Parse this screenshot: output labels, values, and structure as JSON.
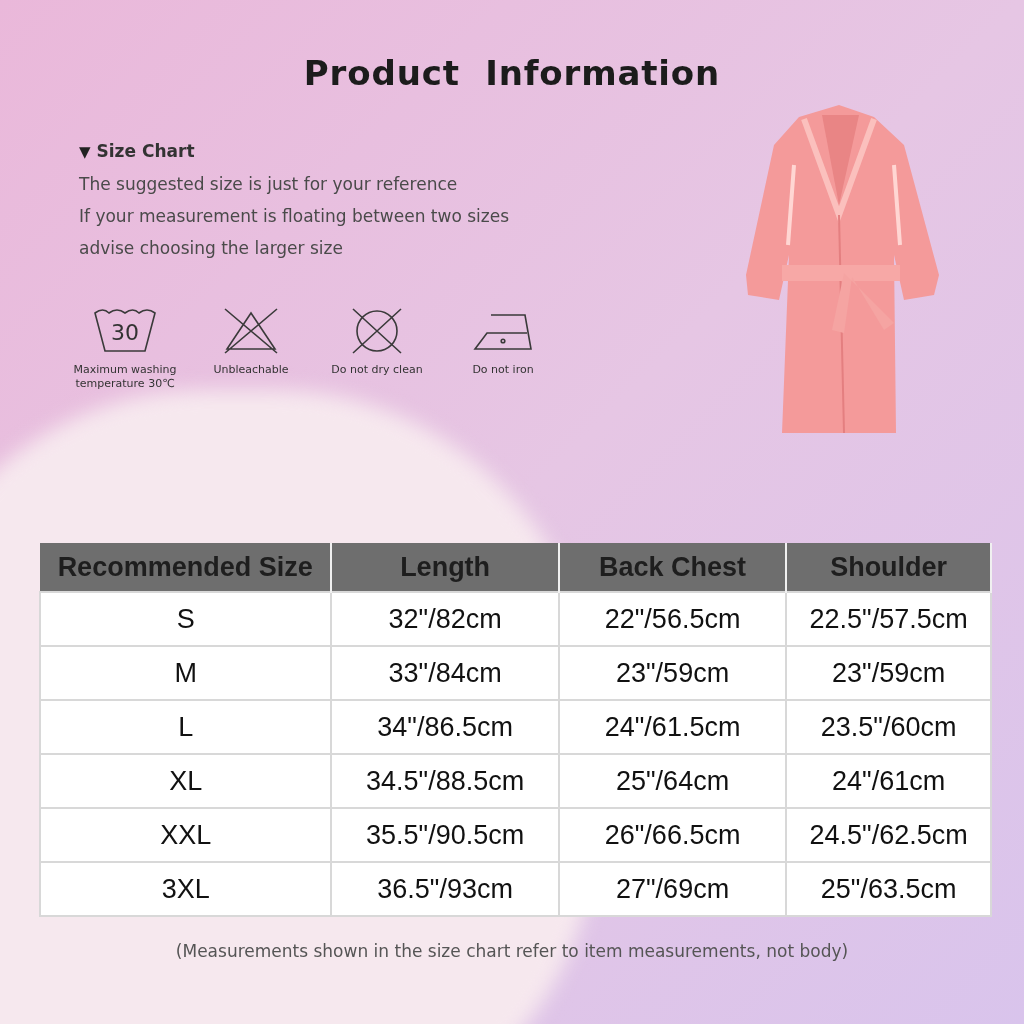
{
  "title": "Product  Information",
  "size_chart": {
    "marker": "▼",
    "heading": "Size Chart",
    "notes": [
      "The suggested size is just for your reference",
      "If your measurement is floating between two sizes",
      "advise choosing the larger size"
    ]
  },
  "care": [
    {
      "kind": "wash",
      "icon_text": "30",
      "label": "Maximum washing temperature 30℃"
    },
    {
      "kind": "no-bleach",
      "label": "Unbleachable"
    },
    {
      "kind": "no-dry-clean",
      "label": "Do not dry clean"
    },
    {
      "kind": "no-iron",
      "label": "Do not iron"
    }
  ],
  "table": {
    "columns": [
      "Recommended Size",
      "Length",
      "Back Chest",
      "Shoulder"
    ],
    "rows": [
      [
        "S",
        "32\"/82cm",
        "22\"/56.5cm",
        "22.5\"/57.5cm"
      ],
      [
        "M",
        "33\"/84cm",
        "23\"/59cm",
        "23\"/59cm"
      ],
      [
        "L",
        "34\"/86.5cm",
        "24\"/61.5cm",
        "23.5\"/60cm"
      ],
      [
        "XL",
        "34.5\"/88.5cm",
        "25\"/64cm",
        "24\"/61cm"
      ],
      [
        "XXL",
        "35.5\"/90.5cm",
        "26\"/66.5cm",
        "24.5\"/62.5cm"
      ],
      [
        "3XL",
        "36.5\"/93cm",
        "27\"/69cm",
        "25\"/63.5cm"
      ]
    ]
  },
  "footnote": "(Measurements shown in the size chart refer to item measurements, not body)"
}
